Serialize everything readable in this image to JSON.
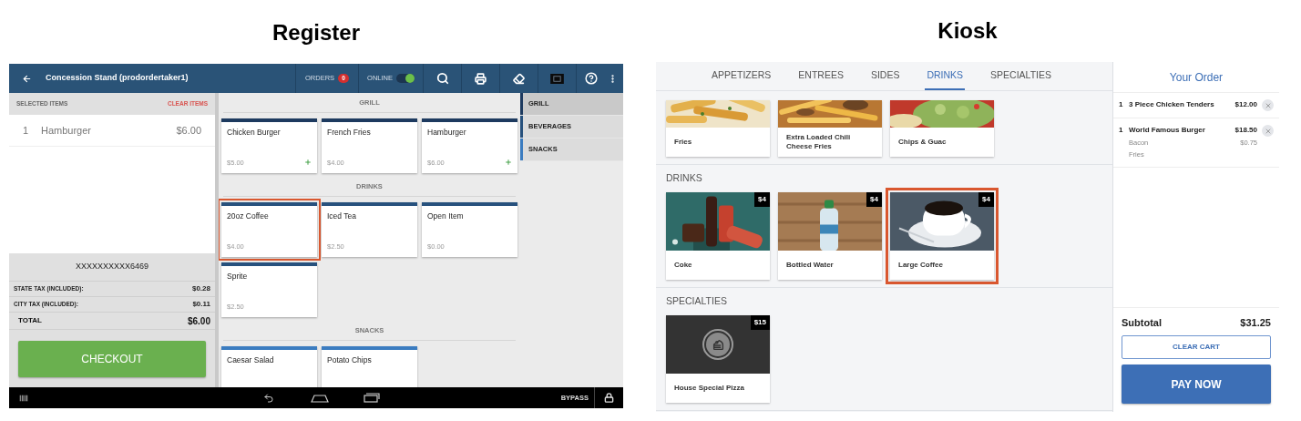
{
  "register": {
    "heading": "Register",
    "title": "Concession Stand (prodordertaker1)",
    "orders": {
      "label": "ORDERS",
      "count": "0"
    },
    "online": {
      "label": "ONLINE",
      "on": true
    },
    "selected_items": {
      "label": "SELECTED ITEMS",
      "clear": "CLEAR ITEMS",
      "rows": [
        {
          "qty": "1",
          "name": "Hamburger",
          "price": "$6.00"
        }
      ]
    },
    "card_number": "XXXXXXXXXX6469",
    "taxes": [
      {
        "label": "STATE TAX (INCLUDED):",
        "value": "$0.28"
      },
      {
        "label": "CITY TAX (INCLUDED):",
        "value": "$0.11"
      }
    ],
    "total": {
      "label": "TOTAL",
      "value": "$6.00"
    },
    "checkout": "CHECKOUT",
    "sections": [
      {
        "title": "GRILL",
        "color": "#1d3a5f",
        "items": [
          {
            "name": "Chicken Burger",
            "price": "$5.00",
            "modifiers": true,
            "selected": false
          },
          {
            "name": "French Fries",
            "price": "$4.00",
            "modifiers": false,
            "selected": false
          },
          {
            "name": "Hamburger",
            "price": "$6.00",
            "modifiers": true,
            "selected": false
          }
        ]
      },
      {
        "title": "DRINKS",
        "color": "#27517d",
        "items": [
          {
            "name": "20oz Coffee",
            "price": "$4.00",
            "modifiers": false,
            "selected": true
          },
          {
            "name": "Iced Tea",
            "price": "$2.50",
            "modifiers": false,
            "selected": false
          },
          {
            "name": "Open Item",
            "price": "$0.00",
            "modifiers": false,
            "selected": false
          },
          {
            "name": "Sprite",
            "price": "$2.50",
            "modifiers": false,
            "selected": false
          }
        ]
      },
      {
        "title": "SNACKS",
        "color": "#3b7cc0",
        "items": [
          {
            "name": "Caesar Salad",
            "selected": false
          },
          {
            "name": "Potato Chips",
            "selected": false
          }
        ]
      }
    ],
    "categories": [
      {
        "label": "GRILL",
        "selected": true,
        "color": "#1d3a5f"
      },
      {
        "label": "BEVERAGES",
        "selected": false,
        "color": "#27517d"
      },
      {
        "label": "SNACKS",
        "selected": false,
        "color": "#3b7cc0"
      }
    ],
    "footer": {
      "bypass": "BYPASS"
    }
  },
  "kiosk": {
    "heading": "Kiosk",
    "tabs": [
      {
        "label": "APPETIZERS",
        "selected": false
      },
      {
        "label": "ENTREES",
        "selected": false
      },
      {
        "label": "SIDES",
        "selected": false
      },
      {
        "label": "DRINKS",
        "selected": true
      },
      {
        "label": "SPECIALTIES",
        "selected": false
      }
    ],
    "sections": [
      {
        "kind": "scrolled",
        "items": [
          {
            "kind": "picture",
            "name": "Fries",
            "selected": false
          },
          {
            "kind": "picture",
            "name": "Extra Loaded Chili Cheese Fries",
            "selected": false
          },
          {
            "kind": "picture",
            "name": "Chips & Guac",
            "selected": false
          }
        ]
      },
      {
        "kind": "full",
        "title": "DRINKS",
        "items": [
          {
            "kind": "picture",
            "name": "Coke",
            "price": "$4",
            "selected": false
          },
          {
            "kind": "picture",
            "name": "Bottled Water",
            "price": "$4",
            "selected": false
          },
          {
            "kind": "picture",
            "name": "Large Coffee",
            "price": "$4",
            "selected": true
          }
        ]
      },
      {
        "kind": "full",
        "title": "SPECIALTIES",
        "items": [
          {
            "kind": "placeholder",
            "name": "House Special Pizza",
            "price": "$15",
            "selected": false
          }
        ]
      }
    ],
    "order": {
      "title": "Your Order",
      "items": [
        {
          "qty": "1",
          "name": "3 Piece Chicken Tenders",
          "price": "$12.00"
        },
        {
          "qty": "1",
          "name": "World Famous Burger",
          "price": "$18.50",
          "modifiers": [
            {
              "name": "Bacon",
              "price": "$0.75"
            },
            {
              "name": "Fries"
            }
          ]
        }
      ],
      "subtotal": {
        "label": "Subtotal",
        "value": "$31.25"
      },
      "clear": "CLEAR CART",
      "pay": "PAY NOW"
    }
  }
}
